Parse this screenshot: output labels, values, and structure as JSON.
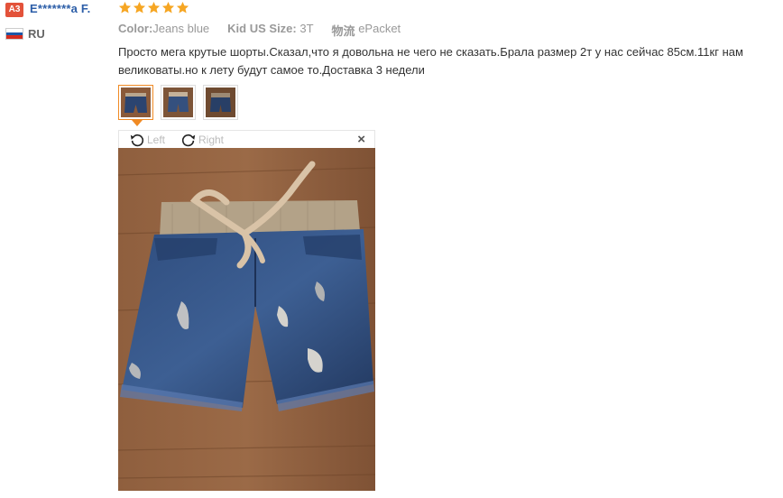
{
  "reviewer": {
    "avatar_text": "A3",
    "name": "E*******a F.",
    "rating": 5,
    "country": "RU",
    "flag_colors": [
      "#ffffff",
      "#1c57a7",
      "#d52b1e"
    ]
  },
  "review": {
    "attributes": [
      {
        "label": "Color:",
        "value": "Jeans blue"
      },
      {
        "label": "Kid US Size:",
        "value": "3T"
      },
      {
        "label": "物流",
        "value": "ePacket"
      }
    ],
    "text": "Просто мега крутые шорты.Сказал,что я довольна не чего не сказать.Брала размер 2т у нас сейчас 85см.11кг нам великоваты.но к лету будут самое то.Доставка 3 недели"
  },
  "gallery": {
    "thumbnail_count": 3,
    "active_index": 0
  },
  "viewer": {
    "rotate_left_label": "Left",
    "rotate_right_label": "Right",
    "close_symbol": "×"
  },
  "colors": {
    "star": "#f6a623",
    "accent": "#f08a24",
    "link": "#2c5ea8",
    "badge": "#e3523a"
  }
}
